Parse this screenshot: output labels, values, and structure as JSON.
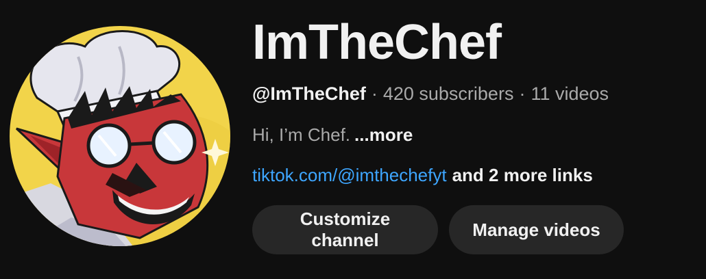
{
  "channel": {
    "name": "ImTheChef",
    "handle": "@ImTheChef",
    "subscribers": "420 subscribers",
    "videos": "11 videos",
    "separator": "·",
    "description": "Hi, I’m Chef.",
    "more_label": "...more",
    "link": "tiktok.com/@imthechefyt",
    "more_links": "and 2 more links"
  },
  "buttons": {
    "customize": "Customize channel",
    "manage": "Manage videos"
  },
  "avatar": {
    "icon": "chef-avatar-icon",
    "background_color": "#f2d44a",
    "face_color": "#c8373a"
  },
  "colors": {
    "background": "#0f0f0f",
    "link": "#3ea6ff",
    "button_bg": "#272727",
    "muted_text": "#aaaaaa"
  }
}
